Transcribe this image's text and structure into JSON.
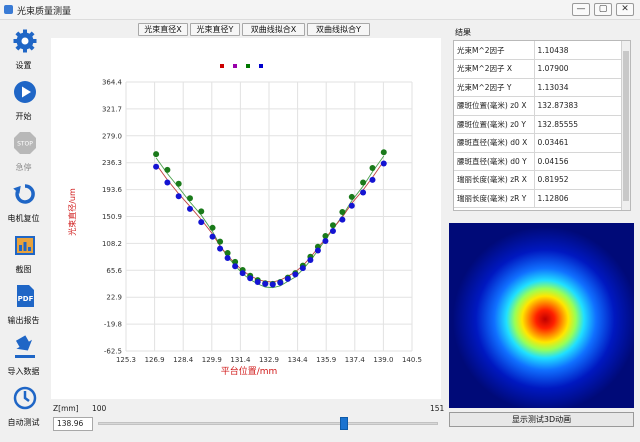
{
  "window": {
    "title": "光束质量测量"
  },
  "sidebar": {
    "items": [
      {
        "label": "设置",
        "icon": "gear-icon"
      },
      {
        "label": "开始",
        "icon": "play-icon"
      },
      {
        "label": "急停",
        "icon": "stop-icon"
      },
      {
        "label": "电机复位",
        "icon": "reset-icon"
      },
      {
        "label": "截图",
        "icon": "screenshot-icon"
      },
      {
        "label": "输出报告",
        "icon": "pdf-icon"
      },
      {
        "label": "导入数据",
        "icon": "import-icon"
      },
      {
        "label": "自动测试",
        "icon": "auto-test-icon"
      }
    ]
  },
  "toolbar": {
    "buttons": [
      "光束直径X",
      "光束直径Y",
      "双曲线拟合X",
      "双曲线拟合Y"
    ]
  },
  "chart_data": {
    "type": "scatter",
    "xlabel": "平台位置/mm",
    "ylabel": "光束直径/um",
    "xlim": [
      125.3,
      140.5
    ],
    "ylim": [
      -62.5,
      364.4
    ],
    "xticks": [
      "125.3",
      "126.9",
      "128.4",
      "129.9",
      "131.4",
      "132.9",
      "134.4",
      "135.9",
      "137.4",
      "139.0",
      "140.5"
    ],
    "yticks": [
      "364.4",
      "321.7",
      "279.0",
      "236.3",
      "193.6",
      "150.9",
      "108.2",
      "65.6",
      "22.9",
      "-19.8",
      "-62.5"
    ],
    "grid": true,
    "legend_colors": [
      "#cc0000",
      "#9900aa",
      "#007700",
      "#0000cc"
    ],
    "series": [
      {
        "color": "#1a7a1a",
        "x": [
          126.9,
          127.5,
          128.1,
          128.7,
          129.3,
          129.9,
          130.3,
          130.7,
          131.1,
          131.5,
          131.9,
          132.3,
          132.7,
          133.1,
          133.5,
          133.9,
          134.3,
          134.7,
          135.1,
          135.5,
          135.9,
          136.3,
          136.8,
          137.3,
          137.9,
          138.4,
          139.0
        ],
        "values": [
          250,
          225,
          203,
          180,
          159,
          133,
          111,
          93,
          79,
          66,
          57,
          50,
          45,
          44,
          47,
          54,
          61,
          73,
          87,
          103,
          120,
          137,
          158,
          182,
          205,
          228,
          253
        ]
      },
      {
        "color": "#1414d2",
        "x": [
          126.9,
          127.5,
          128.1,
          128.7,
          129.3,
          129.9,
          130.3,
          130.7,
          131.1,
          131.5,
          131.9,
          132.3,
          132.7,
          133.1,
          133.5,
          133.9,
          134.3,
          134.7,
          135.1,
          135.5,
          135.9,
          136.3,
          136.8,
          137.3,
          137.9,
          138.4,
          139.0
        ],
        "values": [
          230,
          205,
          183,
          163,
          142,
          119,
          100,
          85,
          72,
          61,
          53,
          47,
          44,
          43,
          46,
          52,
          59,
          69,
          82,
          97,
          112,
          128,
          146,
          168,
          189,
          209,
          235
        ]
      }
    ]
  },
  "results": {
    "label": "结果",
    "rows": [
      {
        "key": "光束M^2因子",
        "value": "1.10438"
      },
      {
        "key": "光束M^2因子 X",
        "value": "1.07900"
      },
      {
        "key": "光束M^2因子 Y",
        "value": "1.13034"
      },
      {
        "key": "腰斑位置(毫米) z0 X",
        "value": "132.87383"
      },
      {
        "key": "腰斑位置(毫米) z0 Y",
        "value": "132.85555"
      },
      {
        "key": "腰斑直径(毫米) d0 X",
        "value": "0.03461"
      },
      {
        "key": "腰斑直径(毫米) d0 Y",
        "value": "0.04156"
      },
      {
        "key": "瑞丽长度(毫米) zR X",
        "value": "0.81952"
      },
      {
        "key": "瑞丽长度(毫米) zR Y",
        "value": "1.12806"
      }
    ]
  },
  "heatmap": {
    "button_label": "显示测试3D动画"
  },
  "zcontrol": {
    "label": "Z[mm]",
    "min": "100",
    "max": "151",
    "value": "138.96",
    "fraction": 0.7247
  }
}
